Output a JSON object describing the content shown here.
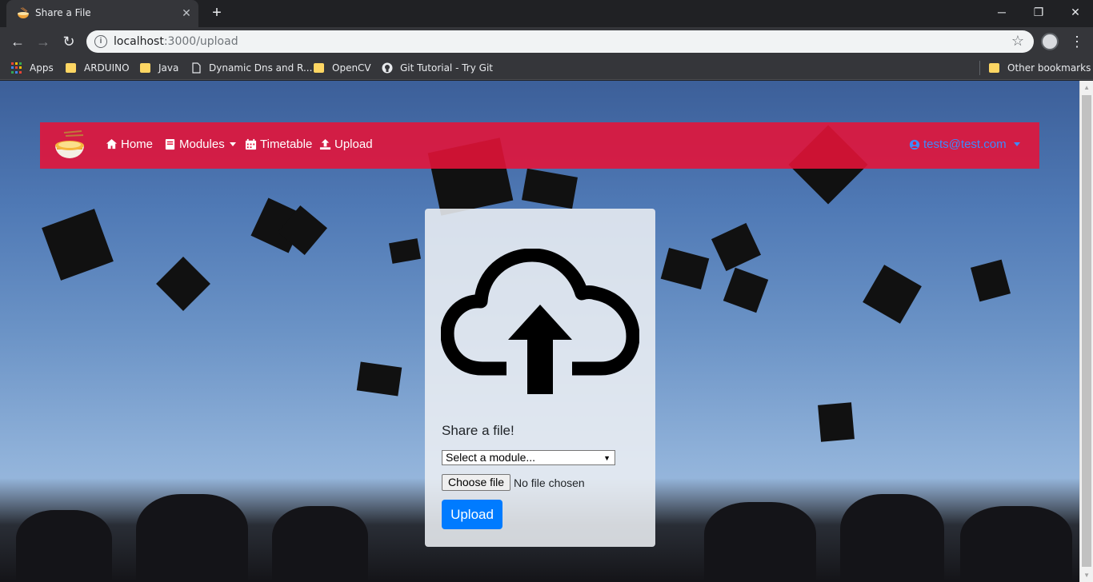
{
  "browser": {
    "tab_title": "Share a File",
    "tab_favicon": "ramen-bowl-icon",
    "url_host": "localhost",
    "url_rest": ":3000/upload",
    "bookmarks": [
      {
        "label": "Apps",
        "icon": "apps-grid-icon"
      },
      {
        "label": "ARDUINO",
        "icon": "folder-icon"
      },
      {
        "label": "Java",
        "icon": "folder-icon"
      },
      {
        "label": "Dynamic Dns and R...",
        "icon": "page-icon"
      },
      {
        "label": "OpenCV",
        "icon": "folder-icon"
      },
      {
        "label": "Git Tutorial - Try Git",
        "icon": "github-icon"
      }
    ],
    "other_bookmarks": "Other bookmarks"
  },
  "navbar": {
    "brand_icon": "ramen-bowl-icon",
    "links": [
      {
        "label": "Home",
        "icon": "home-icon"
      },
      {
        "label": "Modules",
        "icon": "book-icon",
        "dropdown": true
      },
      {
        "label": "Timetable",
        "icon": "calendar-icon"
      },
      {
        "label": "Upload",
        "icon": "upload-icon"
      }
    ],
    "user": "tests@test.com"
  },
  "upload_card": {
    "icon": "cloud-upload-icon",
    "title": "Share a file!",
    "module_select": "Select a module...",
    "choose_file": "Choose file",
    "no_file": "No file chosen",
    "submit": "Upload"
  },
  "colors": {
    "navbar": "#e61238",
    "user_link": "#3d8bfd",
    "primary_button": "#007bff"
  }
}
